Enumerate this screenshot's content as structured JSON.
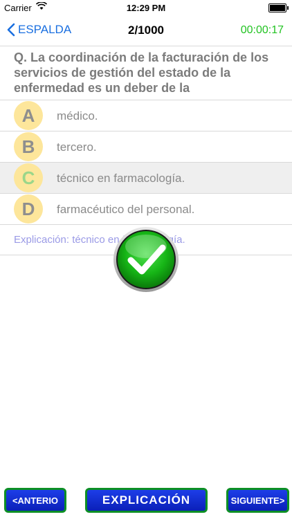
{
  "status_bar": {
    "carrier": "Carrier",
    "time": "12:29 PM"
  },
  "nav": {
    "back_label": "ESPALDA",
    "counter": "2/1000",
    "timer": "00:00:17"
  },
  "question": "Q. La coordinación de la facturación de los servicios de gestión del estado de la enfermedad es un deber de la",
  "answers": [
    {
      "letter": "A",
      "text": "médico."
    },
    {
      "letter": "B",
      "text": "tercero."
    },
    {
      "letter": "C",
      "text": "técnico en farmacología."
    },
    {
      "letter": "D",
      "text": "farmacéutico del personal."
    }
  ],
  "explanation": "Explicación: técnico en farmacología.",
  "buttons": {
    "prev": "<ANTERIO",
    "explain": "EXPLICACIÓN",
    "next": "SIGUIENTE>"
  },
  "colors": {
    "accent": "#1a6fe0",
    "timer": "#22c322",
    "badge": "#fde69b",
    "button": "#1d3ee8",
    "button_border": "#0d8f25"
  }
}
